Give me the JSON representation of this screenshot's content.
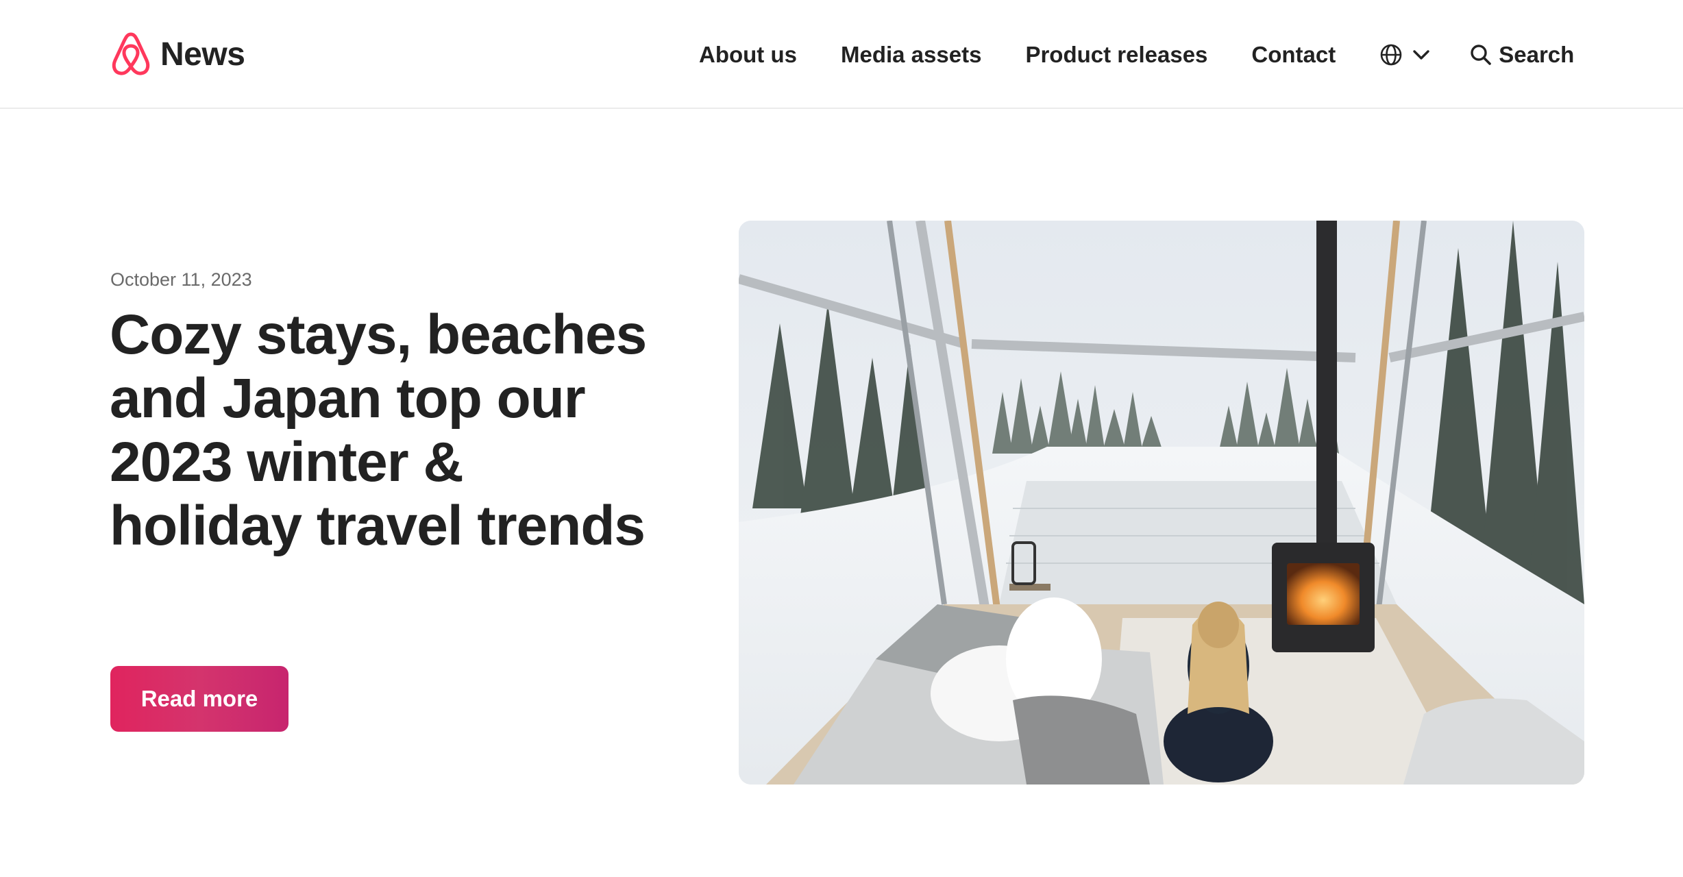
{
  "header": {
    "logo_text": "News",
    "logo_icon": "airbnb-belo-icon",
    "nav": {
      "about": "About us",
      "media": "Media assets",
      "products": "Product releases",
      "contact": "Contact"
    },
    "language_icon": "globe-icon",
    "search_label": "Search"
  },
  "hero": {
    "date": "October 11, 2023",
    "title": "Cozy stays, beaches and Japan top our 2023 winter & holiday travel trends",
    "button_label": "Read more",
    "image_alt": "Woman sitting by a fireplace in a glass cabin overlooking a snowy forest"
  },
  "colors": {
    "brand": "#ff385c",
    "button_start": "#e0245e",
    "button_end": "#c7256e",
    "text": "#222222",
    "muted": "#6a6a6a"
  }
}
